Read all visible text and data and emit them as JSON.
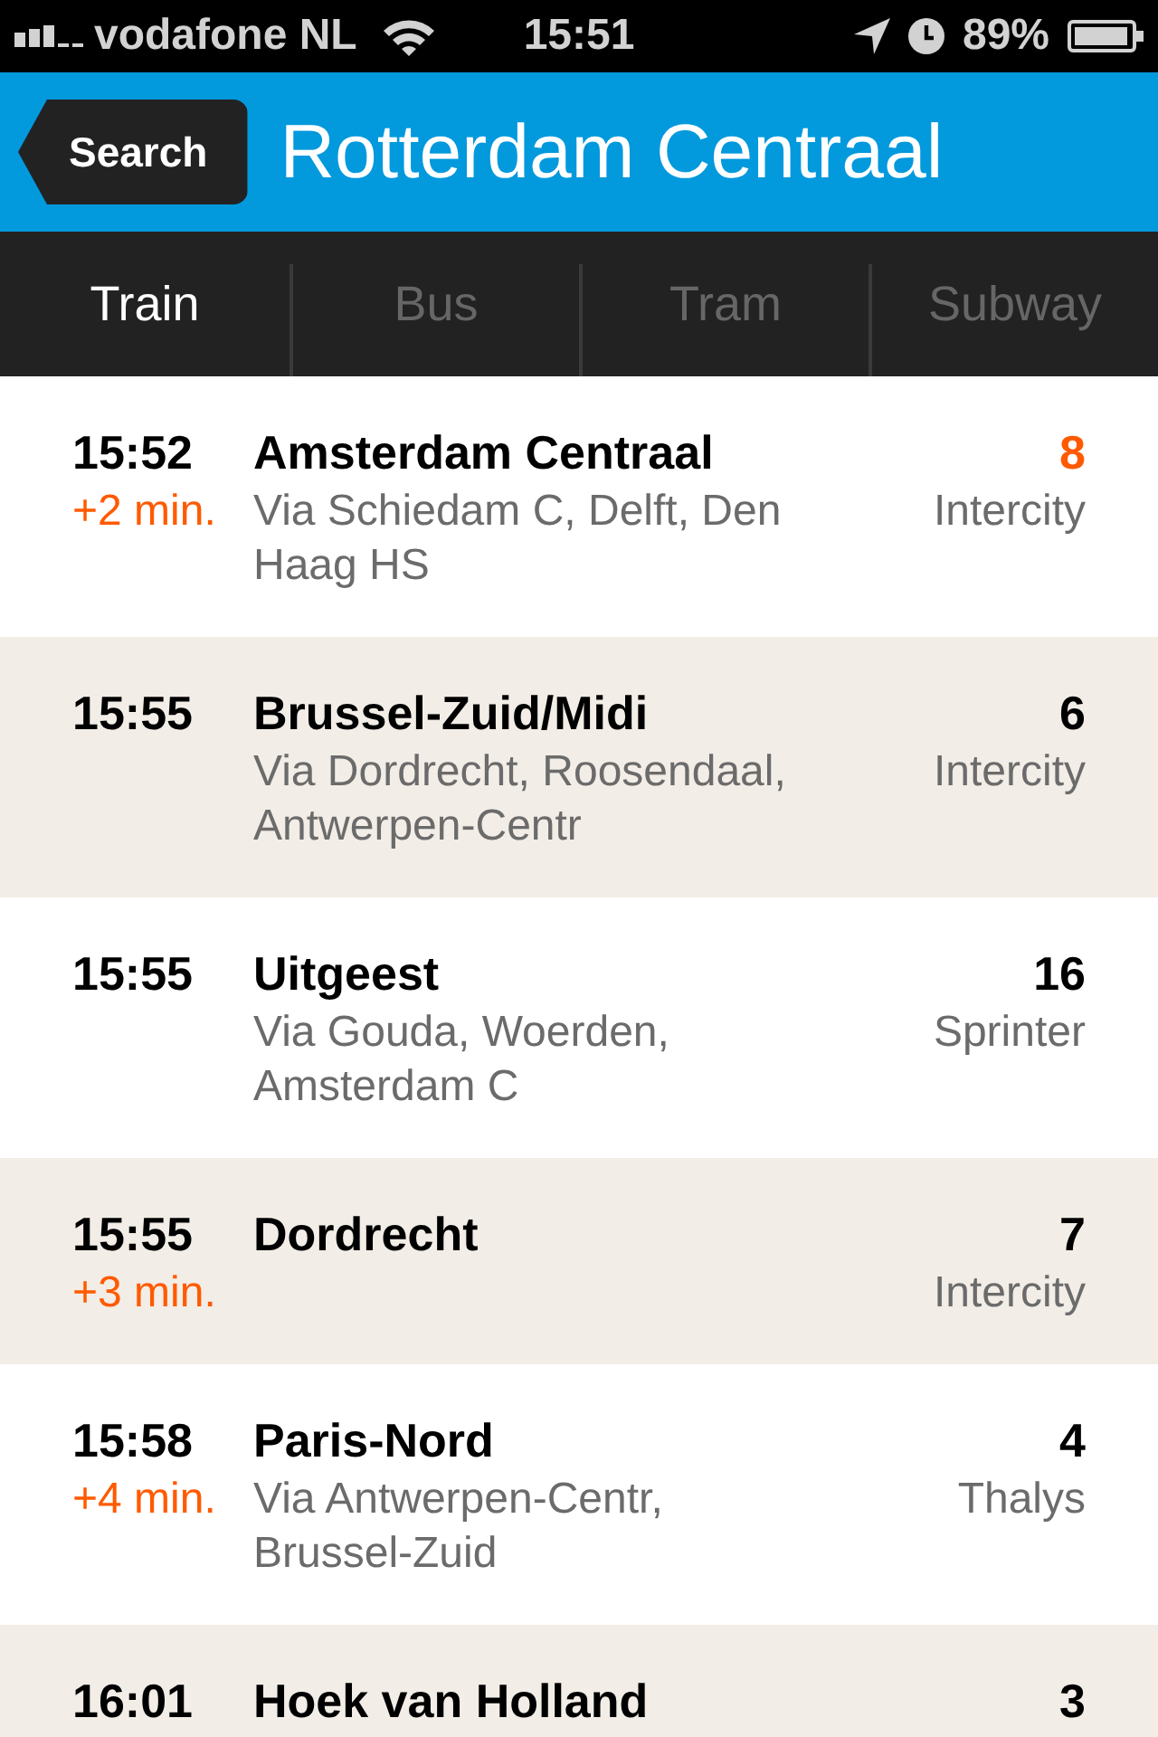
{
  "status_bar": {
    "carrier": "vodafone NL",
    "time": "15:51",
    "battery": "89%"
  },
  "header": {
    "back_button": "Search",
    "title": "Rotterdam Centraal"
  },
  "tabs": [
    {
      "label": "Train",
      "selected": true
    },
    {
      "label": "Bus",
      "selected": false
    },
    {
      "label": "Tram",
      "selected": false
    },
    {
      "label": "Subway",
      "selected": false
    }
  ],
  "departures": [
    {
      "time": "15:52",
      "delay": "+2 min.",
      "destination": "Amsterdam Centraal",
      "via": "Via Schiedam C, Delft, Den Haag HS",
      "platform": "8",
      "platform_changed": true,
      "train_type": "Intercity"
    },
    {
      "time": "15:55",
      "destination": "Brussel-Zuid/Midi",
      "via": "Via Dordrecht, Roosendaal, Antwerpen-Centr",
      "platform": "6",
      "platform_changed": false,
      "train_type": "Intercity"
    },
    {
      "time": "15:55",
      "destination": "Uitgeest",
      "via": "Via Gouda, Woerden, Amsterdam C",
      "platform": "16",
      "platform_changed": false,
      "train_type": "Sprinter"
    },
    {
      "time": "15:55",
      "delay": "+3 min.",
      "destination": "Dordrecht",
      "platform": "7",
      "platform_changed": false,
      "train_type": "Intercity"
    },
    {
      "time": "15:58",
      "delay": "+4 min.",
      "destination": "Paris-Nord",
      "via": "Via Antwerpen-Centr, Brussel-Zuid",
      "platform": "4",
      "platform_changed": false,
      "train_type": "Thalys"
    },
    {
      "time": "16:01",
      "destination": "Hoek van Holland",
      "platform": "3",
      "platform_changed": false
    }
  ]
}
